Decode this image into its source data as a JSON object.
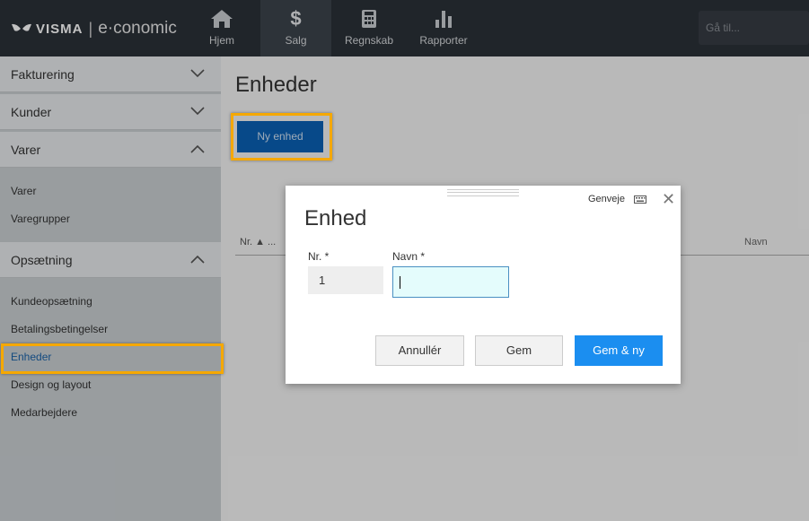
{
  "app": {
    "logo_brand": "VISMA",
    "logo_separator": "|",
    "logo_product": "e·conomic"
  },
  "topnav": [
    {
      "label": "Hjem",
      "icon": "home-icon"
    },
    {
      "label": "Salg",
      "icon": "dollar-icon",
      "active": true
    },
    {
      "label": "Regnskab",
      "icon": "calculator-icon"
    },
    {
      "label": "Rapporter",
      "icon": "bar-chart-icon"
    }
  ],
  "search": {
    "placeholder": "Gå til..."
  },
  "sidebar": {
    "sections": [
      {
        "label": "Fakturering",
        "expanded": false
      },
      {
        "label": "Kunder",
        "expanded": false
      },
      {
        "label": "Varer",
        "expanded": true,
        "items": [
          "Varer",
          "Varegrupper"
        ]
      },
      {
        "label": "Opsætning",
        "expanded": true,
        "items": [
          "Kundeopsætning",
          "Betalingsbetingelser",
          "Enheder",
          "Design og layout",
          "Medarbejdere"
        ]
      }
    ],
    "current_item": "Enheder"
  },
  "main": {
    "title": "Enheder",
    "new_button": "Ny enhed",
    "columns": {
      "nr": "Nr. ▲ ...",
      "navn": "Navn"
    }
  },
  "modal": {
    "shortcut_label": "Genveje",
    "close": "✕",
    "title": "Enhed",
    "nr_label": "Nr. *",
    "nr_value": "1",
    "navn_label": "Navn *",
    "navn_value": "",
    "cancel": "Annullér",
    "save": "Gem",
    "save_new": "Gem & ny"
  },
  "colors": {
    "topbar": "#2b3138",
    "primary": "#1b8ef0",
    "highlight": "#f5a800"
  }
}
